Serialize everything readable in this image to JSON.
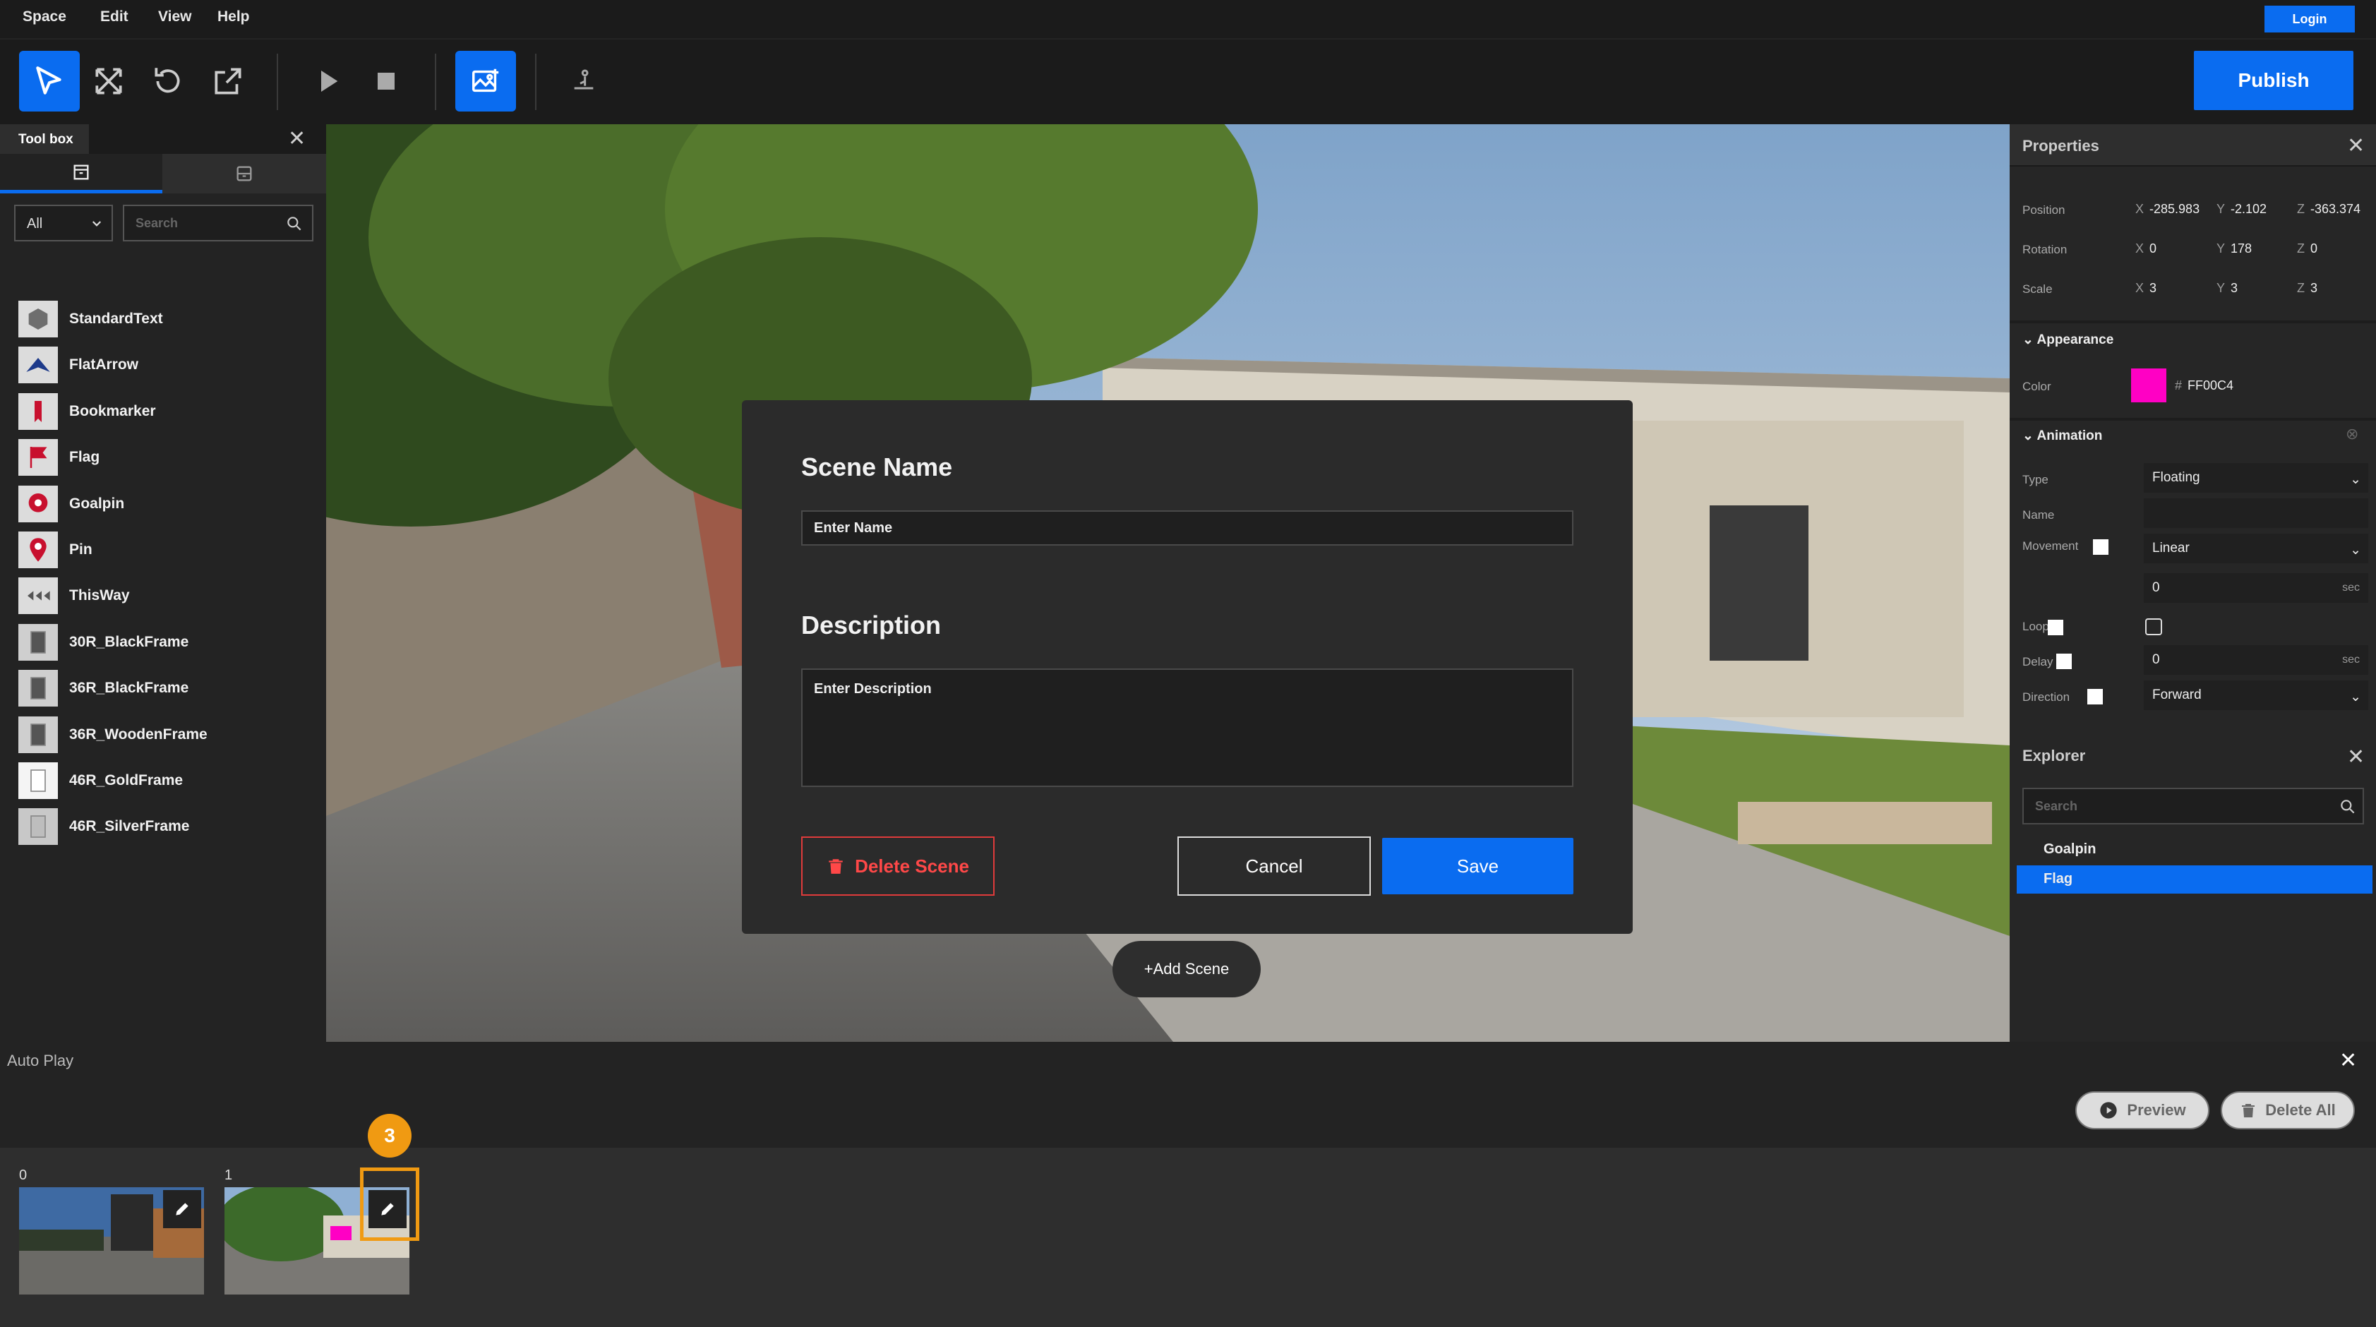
{
  "menu": {
    "items": [
      "Space",
      "Edit",
      "View",
      "Help"
    ],
    "login": "Login"
  },
  "toolbar": {
    "publish": "Publish",
    "icons": [
      "select-cursor-icon",
      "move-arrows-icon",
      "rotate-icon",
      "scale-icon",
      "play-icon",
      "stop-icon",
      "scene-image-icon",
      "person-marker-icon"
    ]
  },
  "toolbox": {
    "title": "Tool box",
    "filter": "All",
    "search_placeholder": "Search",
    "items": [
      {
        "label": "StandardText",
        "icon": "hexagon-icon",
        "color": "#6e6e6e"
      },
      {
        "label": "FlatArrow",
        "icon": "arrow-icon",
        "color": "#1d3a8a"
      },
      {
        "label": "Bookmarker",
        "icon": "bookmark-icon",
        "color": "#c8102e"
      },
      {
        "label": "Flag",
        "icon": "flag-icon",
        "color": "#c8102e"
      },
      {
        "label": "Goalpin",
        "icon": "goal-pin-icon",
        "color": "#c8102e"
      },
      {
        "label": "Pin",
        "icon": "pin-icon",
        "color": "#c8102e"
      },
      {
        "label": "ThisWay",
        "icon": "this-way-icon",
        "color": "#555555"
      },
      {
        "label": "30R_BlackFrame",
        "icon": "frame-icon",
        "color": "#555555"
      },
      {
        "label": "36R_BlackFrame",
        "icon": "frame-icon",
        "color": "#555555"
      },
      {
        "label": "36R_WoodenFrame",
        "icon": "frame-icon",
        "color": "#555555"
      },
      {
        "label": "46R_GoldFrame",
        "icon": "frame-icon",
        "color": "#ffffff"
      },
      {
        "label": "46R_SilverFrame",
        "icon": "frame-icon",
        "color": "#bdbdbd"
      }
    ]
  },
  "modal": {
    "scene_name_heading": "Scene Name",
    "scene_name_placeholder": "Enter Name",
    "description_heading": "Description",
    "description_placeholder": "Enter Description",
    "delete_label": "Delete Scene",
    "cancel_label": "Cancel",
    "save_label": "Save"
  },
  "viewport": {
    "add_scene": "+Add Scene"
  },
  "properties": {
    "title": "Properties",
    "transform": {
      "position": {
        "label": "Position",
        "x": "-285.983",
        "y": "-2.102",
        "z": "-363.374"
      },
      "rotation": {
        "label": "Rotation",
        "x": "0",
        "y": "178",
        "z": "0"
      },
      "scale": {
        "label": "Scale",
        "x": "3",
        "y": "3",
        "z": "3"
      }
    },
    "appearance": {
      "title": "Appearance",
      "color_label": "Color",
      "color_hex": "FF00C4",
      "color": "#FF00C4",
      "hash": "#"
    },
    "animation": {
      "title": "Animation",
      "type_label": "Type",
      "type_value": "Floating",
      "name_label": "Name",
      "movement_label": "Movement",
      "movement_value": "Linear",
      "duration_value": "0",
      "sec": "sec",
      "loop_label": "Loop",
      "delay_label": "Delay",
      "delay_value": "0",
      "direction_label": "Direction",
      "direction_value": "Forward"
    }
  },
  "explorer": {
    "title": "Explorer",
    "search_placeholder": "Search",
    "items": [
      "Goalpin",
      "Flag"
    ],
    "selected": "Flag"
  },
  "autoplay": {
    "title": "Auto Play",
    "preview": "Preview",
    "delete_all": "Delete All",
    "scenes": [
      {
        "index": "0"
      },
      {
        "index": "1"
      }
    ],
    "badge": "3"
  },
  "colors": {
    "accent": "#0a6cf0",
    "danger": "#e03b3b",
    "highlight": "#f09a12"
  }
}
